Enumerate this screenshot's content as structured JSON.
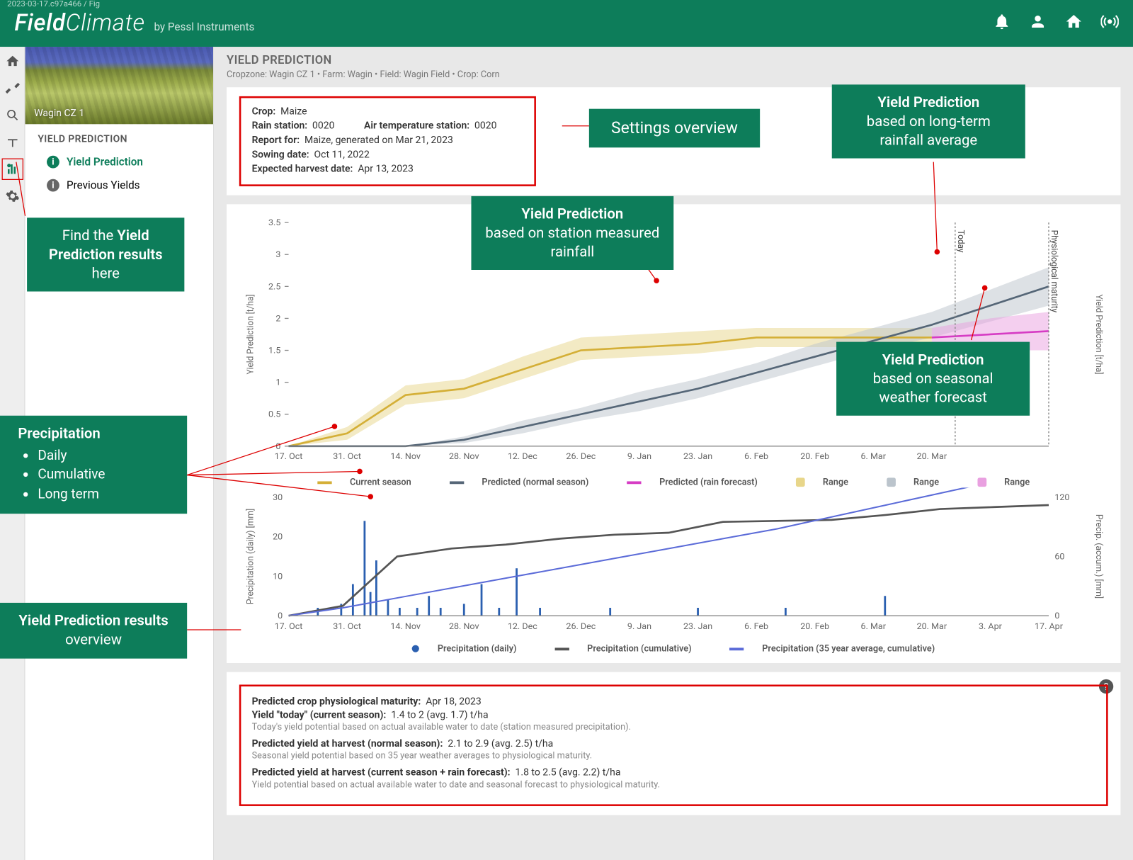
{
  "version_tag": "2023-03-17.c97a466 / Fig",
  "brand": {
    "main_a": "Field",
    "main_b": "Climate",
    "sub": "by Pessl Instruments"
  },
  "sidebar": {
    "thumb_label": "Wagin CZ 1",
    "title": "YIELD PREDICTION",
    "items": [
      {
        "label": "Yield Prediction",
        "active": true
      },
      {
        "label": "Previous Yields",
        "active": false
      }
    ]
  },
  "page": {
    "title": "YIELD PREDICTION",
    "breadcrumb": "Cropzone: Wagin CZ 1 • Farm: Wagin • Field: Wagin Field • Crop: Corn"
  },
  "settings": {
    "crop_label": "Crop:",
    "crop": "Maize",
    "rain_label": "Rain station:",
    "rain_station": "0020",
    "temp_label": "Air temperature station:",
    "temp_station": "0020",
    "report_label": "Report for:",
    "report_for": "Maize,  generated on  Mar 21, 2023",
    "sowing_label": "Sowing date:",
    "sowing_date": "Oct 11, 2022",
    "harvest_label": "Expected harvest date:",
    "harvest_date": "Apr 13, 2023"
  },
  "chart_data": [
    {
      "type": "line",
      "title": "",
      "ylabel": "Yield Prediction [t/ha]",
      "ylabel_right": "Yield Prediction [t/ha]",
      "ylim": [
        0,
        3.5
      ],
      "today_label": "Today",
      "maturity_label": "Physiological maturity",
      "x_ticks": [
        "17. Oct",
        "31. Oct",
        "14. Nov",
        "28. Nov",
        "12. Dec",
        "26. Dec",
        "9. Jan",
        "23. Jan",
        "6. Feb",
        "20. Feb",
        "6. Mar",
        "20. Mar"
      ],
      "x": [
        0,
        1,
        2,
        3,
        4,
        5,
        6,
        7,
        8,
        9,
        10,
        11,
        12,
        13
      ],
      "series": [
        {
          "name": "Current season",
          "color": "#d4af37",
          "values": [
            0,
            0.2,
            0.8,
            0.9,
            1.2,
            1.5,
            1.55,
            1.6,
            1.7,
            1.7,
            1.7,
            1.7,
            null,
            null
          ]
        },
        {
          "name": "Predicted (normal season)",
          "color": "#567",
          "values": [
            0,
            0,
            0,
            0.1,
            0.3,
            0.5,
            0.7,
            0.9,
            1.15,
            1.4,
            1.65,
            1.9,
            2.2,
            2.5
          ]
        },
        {
          "name": "Predicted (rain forecast)",
          "color": "#d63cc4",
          "values": [
            null,
            null,
            null,
            null,
            null,
            null,
            null,
            null,
            null,
            null,
            null,
            1.7,
            1.75,
            1.8
          ]
        }
      ],
      "ranges": [
        {
          "name": "Range",
          "color": "#e8d68a",
          "upper": [
            0,
            0.3,
            0.95,
            1.05,
            1.4,
            1.7,
            1.75,
            1.8,
            1.85,
            1.85,
            1.85,
            1.85
          ],
          "lower": [
            0,
            0.1,
            0.65,
            0.75,
            1.05,
            1.35,
            1.4,
            1.45,
            1.55,
            1.55,
            1.55,
            1.55
          ]
        },
        {
          "name": "Range",
          "color": "#bbc4cc",
          "upper": [
            0,
            0,
            0,
            0.15,
            0.4,
            0.6,
            0.85,
            1.05,
            1.3,
            1.6,
            1.85,
            2.1,
            2.45,
            2.8
          ],
          "lower": [
            0,
            0,
            0,
            0.05,
            0.2,
            0.4,
            0.55,
            0.75,
            1.0,
            1.25,
            1.5,
            1.7,
            1.95,
            2.2
          ]
        },
        {
          "name": "Range",
          "color": "#e9a0e0",
          "upper": [
            null,
            null,
            null,
            null,
            null,
            null,
            null,
            null,
            null,
            null,
            null,
            1.85,
            2.0,
            2.1
          ],
          "lower": [
            null,
            null,
            null,
            null,
            null,
            null,
            null,
            null,
            null,
            null,
            null,
            1.55,
            1.5,
            1.5
          ]
        }
      ],
      "legend": [
        "Current season",
        "Predicted (normal season)",
        "Predicted (rain forecast)",
        "Range",
        "Range",
        "Range"
      ]
    },
    {
      "type": "bar+line",
      "ylabel_left": "Precipitation (daily) [mm]",
      "ylabel_right": "Precip. (accum.) [mm]",
      "ylim_left": [
        0,
        30
      ],
      "ylim_right": [
        0,
        120
      ],
      "x_ticks": [
        "17. Oct",
        "31. Oct",
        "14. Nov",
        "28. Nov",
        "12. Dec",
        "26. Dec",
        "9. Jan",
        "23. Jan",
        "6. Feb",
        "20. Feb",
        "6. Mar",
        "20. Mar",
        "3. Apr",
        "17. Apr"
      ],
      "precip_daily": [
        {
          "x": 0.5,
          "v": 2
        },
        {
          "x": 0.9,
          "v": 3
        },
        {
          "x": 1.1,
          "v": 8
        },
        {
          "x": 1.3,
          "v": 24
        },
        {
          "x": 1.4,
          "v": 6
        },
        {
          "x": 1.5,
          "v": 14
        },
        {
          "x": 1.7,
          "v": 4
        },
        {
          "x": 1.9,
          "v": 2
        },
        {
          "x": 2.2,
          "v": 2
        },
        {
          "x": 2.4,
          "v": 5
        },
        {
          "x": 2.6,
          "v": 2
        },
        {
          "x": 3.0,
          "v": 3
        },
        {
          "x": 3.3,
          "v": 8
        },
        {
          "x": 3.6,
          "v": 2
        },
        {
          "x": 3.9,
          "v": 12
        },
        {
          "x": 4.3,
          "v": 2
        },
        {
          "x": 5.5,
          "v": 2
        },
        {
          "x": 7.0,
          "v": 2
        },
        {
          "x": 8.5,
          "v": 2
        },
        {
          "x": 10.2,
          "v": 5
        }
      ],
      "precip_cumulative": [
        0,
        10,
        60,
        68,
        72,
        78,
        82,
        84,
        95,
        96,
        97,
        102,
        108,
        110,
        112
      ],
      "precip_35yr": [
        0,
        8,
        18,
        28,
        38,
        48,
        58,
        68,
        78,
        88,
        100,
        112,
        124,
        136,
        148
      ],
      "legend": [
        "Precipitation (daily)",
        "Precipitation (cumulative)",
        "Precipitation (35 year average, cumulative)"
      ]
    }
  ],
  "results": {
    "maturity_label": "Predicted crop physiological maturity:",
    "maturity": "Apr 18, 2023",
    "today_label": "Yield \"today\" (current season):",
    "today_value": "1.4 to 2 (avg. 1.7)   t/ha",
    "today_sub": "Today's yield potential based on actual available water to date (station measured precipitation).",
    "normal_label": "Predicted yield at harvest (normal season):",
    "normal_value": "2.1 to 2.9 (avg. 2.5)   t/ha",
    "normal_sub": "Seasonal yield potential based on 35 year weather averages to physiological maturity.",
    "forecast_label": "Predicted yield at harvest (current season + rain forecast):",
    "forecast_value": "1.8 to 2.5 (avg. 2.2)   t/ha",
    "forecast_sub": "Yield potential based on actual available water to date and seasonal forecast to physiological maturity."
  },
  "annotations": {
    "find_here_a": "Find the ",
    "find_here_b": "Yield Prediction results",
    "find_here_c": " here",
    "settings_overview": "Settings overview",
    "yp_station_a": "Yield Prediction",
    "yp_station_b": "based on station measured rainfall",
    "yp_long_a": "Yield Prediction",
    "yp_long_b": "based on long-term rainfall average",
    "yp_seasonal_a": "Yield Prediction",
    "yp_seasonal_b": "based on seasonal weather forecast",
    "precip_title": "Precipitation",
    "precip_items": [
      "Daily",
      "Cumulative",
      "Long term"
    ],
    "results_a": "Yield Prediction results",
    "results_b": " overview"
  }
}
